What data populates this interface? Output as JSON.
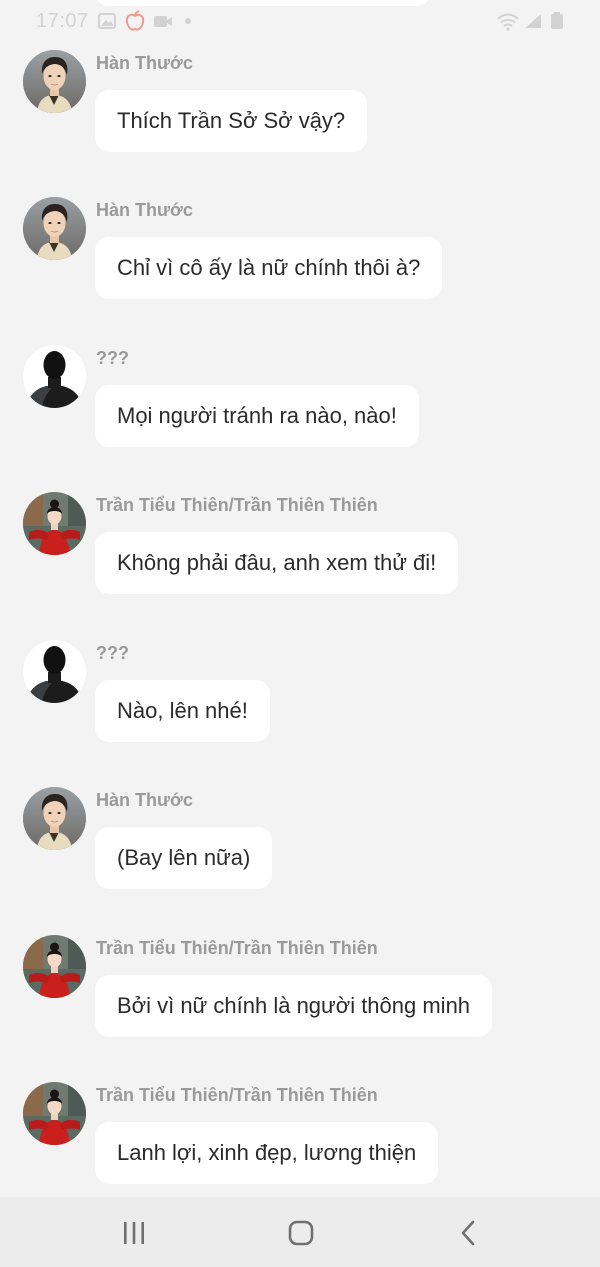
{
  "status_bar": {
    "time": "17:07",
    "icons": [
      "image-icon",
      "apple-icon",
      "video-icon",
      "dot-icon",
      "wifi-icon",
      "signal-icon",
      "battery-icon"
    ]
  },
  "messages": [
    {
      "sender": "Hàn Thước",
      "avatar": "hanthuoc-avatar",
      "text": "Thích Trần Sở Sở vậy?"
    },
    {
      "sender": "Hàn Thước",
      "avatar": "hanthuoc-avatar",
      "text": "Chỉ vì cô ấy là nữ chính thôi à?"
    },
    {
      "sender": "???",
      "avatar": "silhouette-avatar",
      "text": "Mọi người tránh ra nào, nào!"
    },
    {
      "sender": "Trần Tiểu Thiên/Trần Thiên Thiên",
      "avatar": "red-dress-avatar",
      "text": "Không phải đâu, anh xem thử đi!"
    },
    {
      "sender": "???",
      "avatar": "silhouette-avatar",
      "text": "Nào, lên nhé!"
    },
    {
      "sender": "Hàn Thước",
      "avatar": "hanthuoc-avatar",
      "text": "(Bay lên nữa)"
    },
    {
      "sender": "Trần Tiểu Thiên/Trần Thiên Thiên",
      "avatar": "red-dress-avatar",
      "text": "Bởi vì nữ chính là người thông minh"
    },
    {
      "sender": "Trần Tiểu Thiên/Trần Thiên Thiên",
      "avatar": "red-dress-avatar",
      "text": "Lanh lợi, xinh đẹp, lương thiện"
    }
  ],
  "nav_bar": {
    "buttons": [
      "recent-apps-icon",
      "home-icon",
      "back-icon"
    ]
  },
  "colors": {
    "background": "#f3f3f3",
    "bubble": "#ffffff",
    "sender_text": "#9a9a9a",
    "message_text": "#2b2b2b",
    "nav_bar": "#ececec"
  }
}
